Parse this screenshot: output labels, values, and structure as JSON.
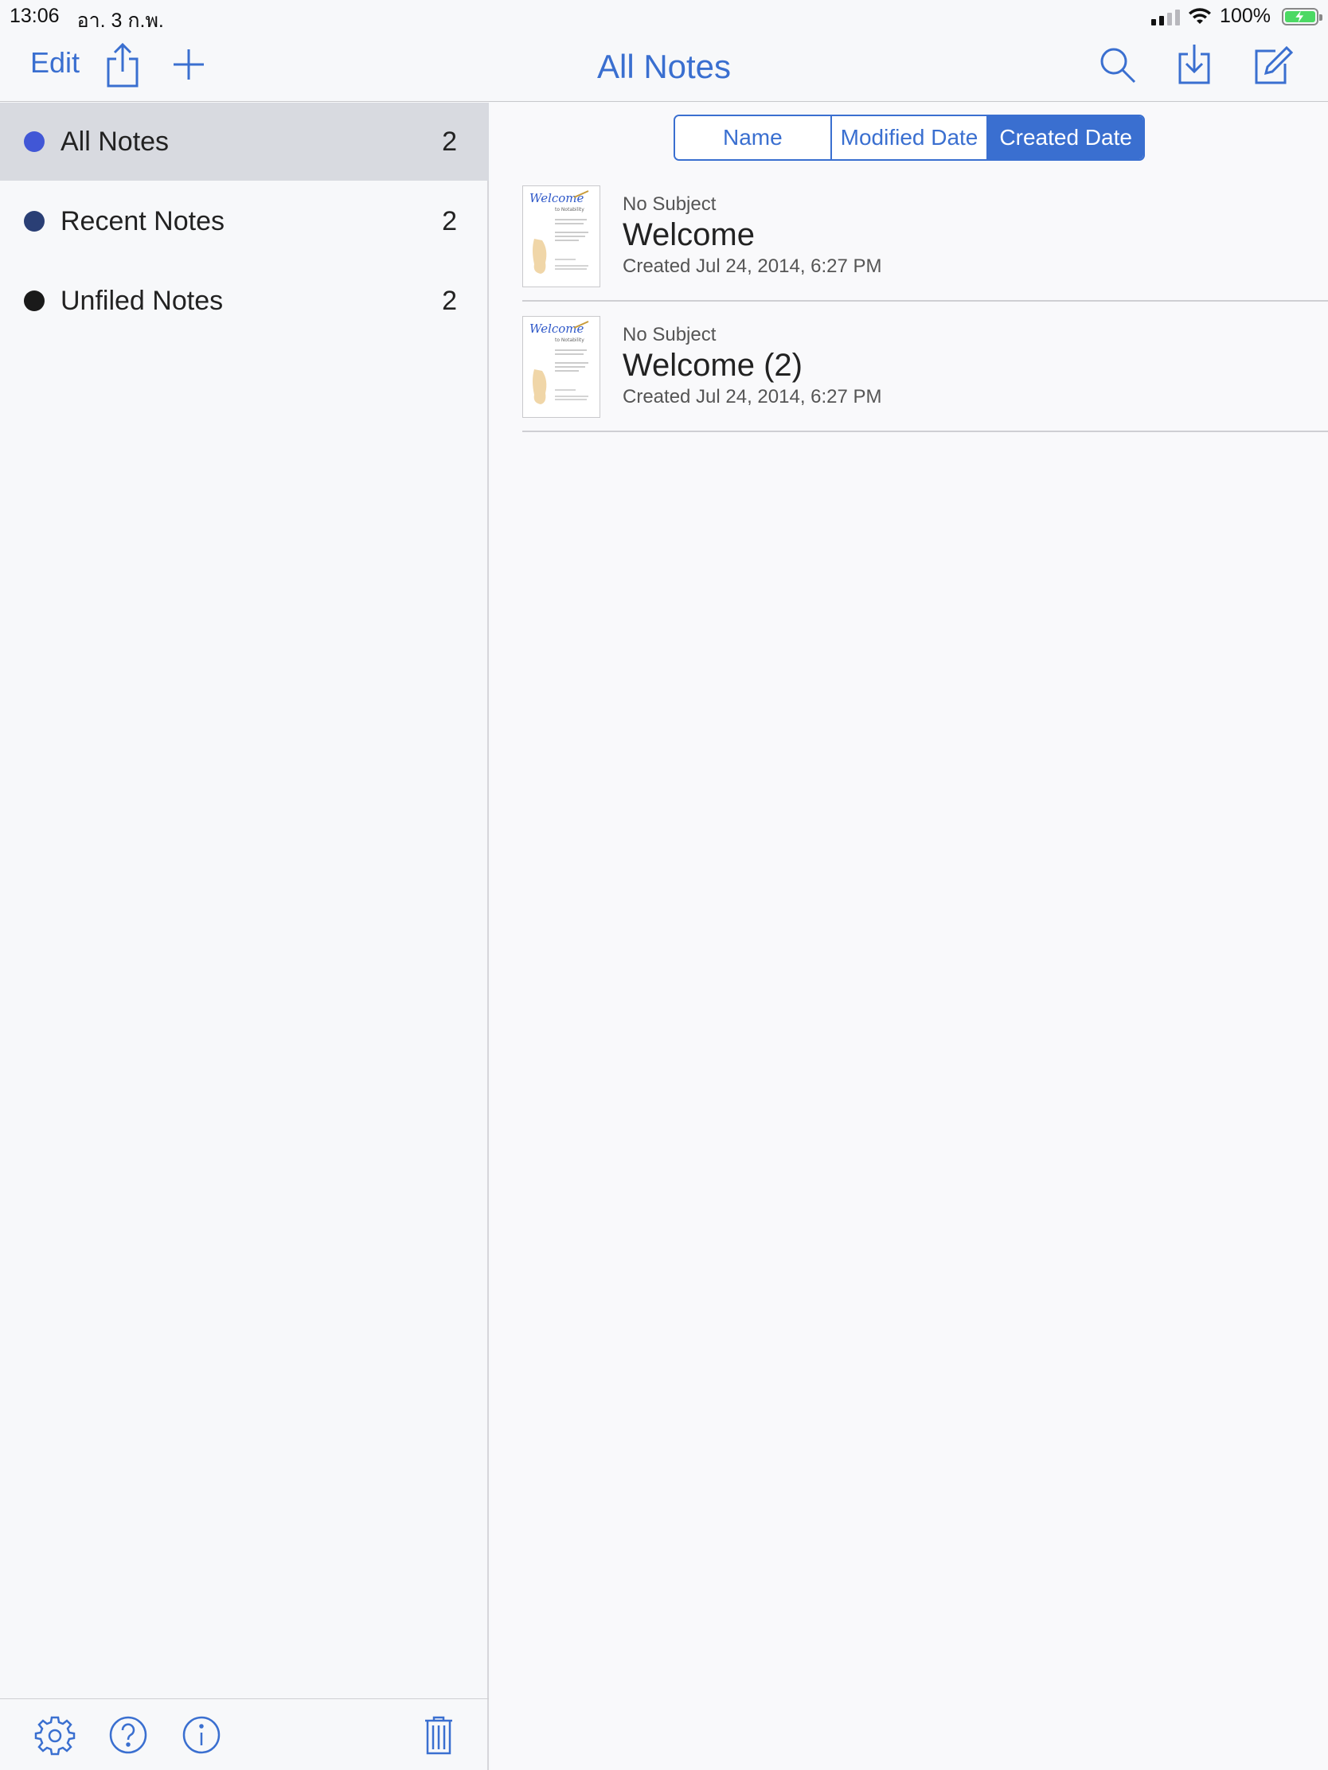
{
  "status": {
    "time": "13:06",
    "date": "อา. 3 ก.พ.",
    "battery": "100%"
  },
  "navbar": {
    "edit_label": "Edit",
    "title": "All Notes",
    "accent_color": "#3a6fd0"
  },
  "sidebar": {
    "items": [
      {
        "label": "All Notes",
        "count": "2",
        "color": "#4157d6"
      },
      {
        "label": "Recent Notes",
        "count": "2",
        "color": "#2a3f75"
      },
      {
        "label": "Unfiled Notes",
        "count": "2",
        "color": "#1a1a1a"
      }
    ]
  },
  "sort": {
    "options": [
      "Name",
      "Modified Date",
      "Created Date"
    ],
    "selected": "Created Date"
  },
  "notes": [
    {
      "subject": "No Subject",
      "title": "Welcome",
      "created": "Created Jul 24, 2014, 6:27 PM",
      "thumb_heading": "Welcome",
      "thumb_sub": "to Notability"
    },
    {
      "subject": "No Subject",
      "title": "Welcome (2)",
      "created": "Created Jul 24, 2014, 6:27 PM",
      "thumb_heading": "Welcome",
      "thumb_sub": "to Notability"
    }
  ],
  "icons": {
    "share": "share-icon",
    "add": "plus-icon",
    "search": "search-icon",
    "import": "import-icon",
    "compose": "compose-icon",
    "settings": "gear-icon",
    "help": "help-icon",
    "info": "info-icon",
    "trash": "trash-icon"
  }
}
